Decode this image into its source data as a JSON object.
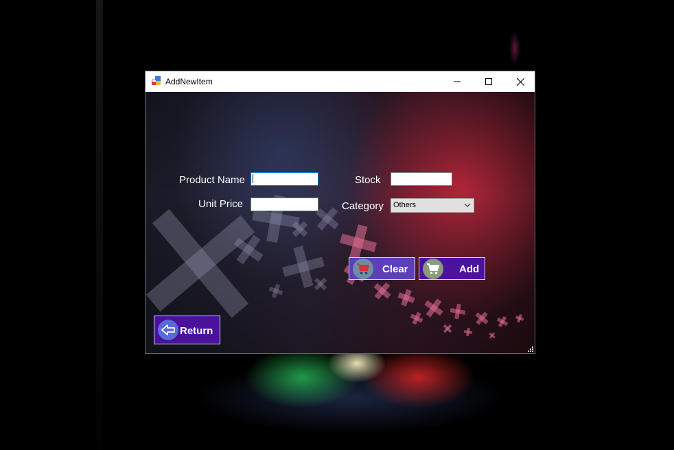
{
  "window": {
    "title": "AddNewItem"
  },
  "form": {
    "product_name_label": "Product Name",
    "product_name_value": "",
    "unit_price_label": "Unit Price",
    "unit_price_value": "",
    "stock_label": "Stock",
    "stock_value": "",
    "category_label": "Category",
    "category_selected": "Others"
  },
  "buttons": {
    "clear_label": "Clear",
    "add_label": "Add",
    "return_label": "Return"
  },
  "icons": {
    "app": "app-icon",
    "minimize": "minimize-icon",
    "maximize": "maximize-icon",
    "close": "close-icon",
    "clear": "shopping-cart-icon",
    "add": "shopping-cart-icon",
    "return": "back-arrow-icon",
    "category_dropdown": "chevron-down-icon"
  },
  "colors": {
    "button_purple": "#4d11a0",
    "button_clear": "#5d3fb8",
    "clear_circle": "#6c8fa4",
    "add_circle": "#8a9a7a",
    "return_circle": "#5a6ad8",
    "focus_border": "#0078d7"
  }
}
